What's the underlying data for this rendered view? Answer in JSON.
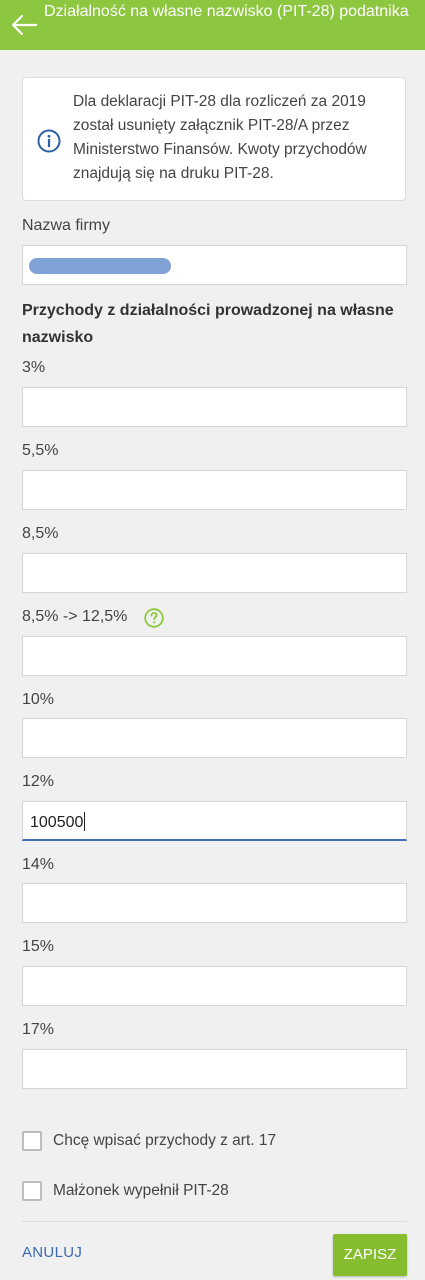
{
  "appbar": {
    "title": "Działalność na własne nazwisko (PIT-28) podatnika",
    "color": "#8dc63f"
  },
  "info": {
    "icon": "info-icon",
    "text": "Dla deklaracji PIT-28 dla rozliczeń za 2019 został usunięty załącznik PIT-28/A przez Ministerstwo Finansów. Kwoty przychodów znajdują się na druku PIT-28."
  },
  "company": {
    "label": "Nazwa firmy",
    "value_redacted": true
  },
  "section_title": "Przychody z działalności prowadzonej na własne nazwisko",
  "rates": [
    {
      "label": "3%",
      "value": ""
    },
    {
      "label": "5,5%",
      "value": ""
    },
    {
      "label": "8,5%",
      "value": ""
    },
    {
      "label": "8,5% -> 12,5%",
      "value": ""
    },
    {
      "label": "10%",
      "value": ""
    },
    {
      "label": "12%",
      "value": "100500"
    },
    {
      "label": "14%",
      "value": ""
    },
    {
      "label": "15%",
      "value": ""
    },
    {
      "label": "17%",
      "value": ""
    }
  ],
  "checkboxes": [
    {
      "label": "Chcę wpisać przychody z art. 17",
      "checked": false
    },
    {
      "label": "Małżonek wypełnił PIT-28",
      "checked": false
    }
  ],
  "actions": {
    "cancel": "ANULUJ",
    "save": "ZAPISZ"
  }
}
